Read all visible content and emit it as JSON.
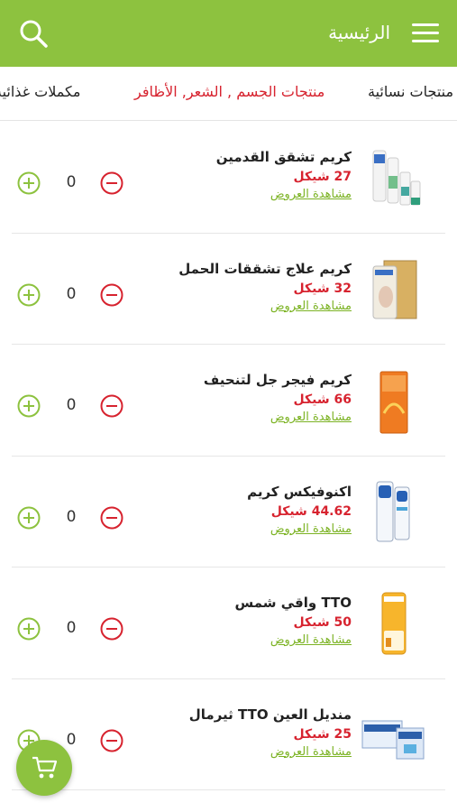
{
  "header": {
    "title": "الرئيسية",
    "bg_color": "#8dc23f"
  },
  "tabs": [
    {
      "label": "منتجات نسائية"
    },
    {
      "label": "منتجات الجسم , الشعر, الأظافر",
      "active": true
    },
    {
      "label": "مكملات غذائية"
    }
  ],
  "products": [
    {
      "name": "كريم تشقق القدمين",
      "price": "27 شيكل",
      "offers": "مشاهدة العروض",
      "qty": "0"
    },
    {
      "name": "كريم علاج تشققات الحمل",
      "price": "32 شيكل",
      "offers": "مشاهدة العروض",
      "qty": "0"
    },
    {
      "name": "كريم فيجر جل لتنحيف",
      "price": "66 شيكل",
      "offers": "مشاهدة العروض",
      "qty": "0"
    },
    {
      "name": "اكنوفيكس كريم",
      "price": "44.62 شيكل",
      "offers": "مشاهدة العروض",
      "qty": "0"
    },
    {
      "name": "TTO واقي شمس",
      "price": "50 شيكل",
      "offers": "مشاهدة العروض",
      "qty": "0"
    },
    {
      "name": "منديل العين TTO ثيرمال",
      "price": "25 شيكل",
      "offers": "مشاهدة العروض",
      "qty": "0"
    }
  ],
  "icons": {
    "search": "search-icon",
    "menu": "hamburger-menu-icon",
    "plus": "plus-circle-icon",
    "minus": "minus-circle-icon",
    "cart": "shopping-cart-icon"
  },
  "colors": {
    "accent": "#8dc23f",
    "price": "#d7232f",
    "minus": "#d7232f",
    "link": "#7cb324"
  }
}
